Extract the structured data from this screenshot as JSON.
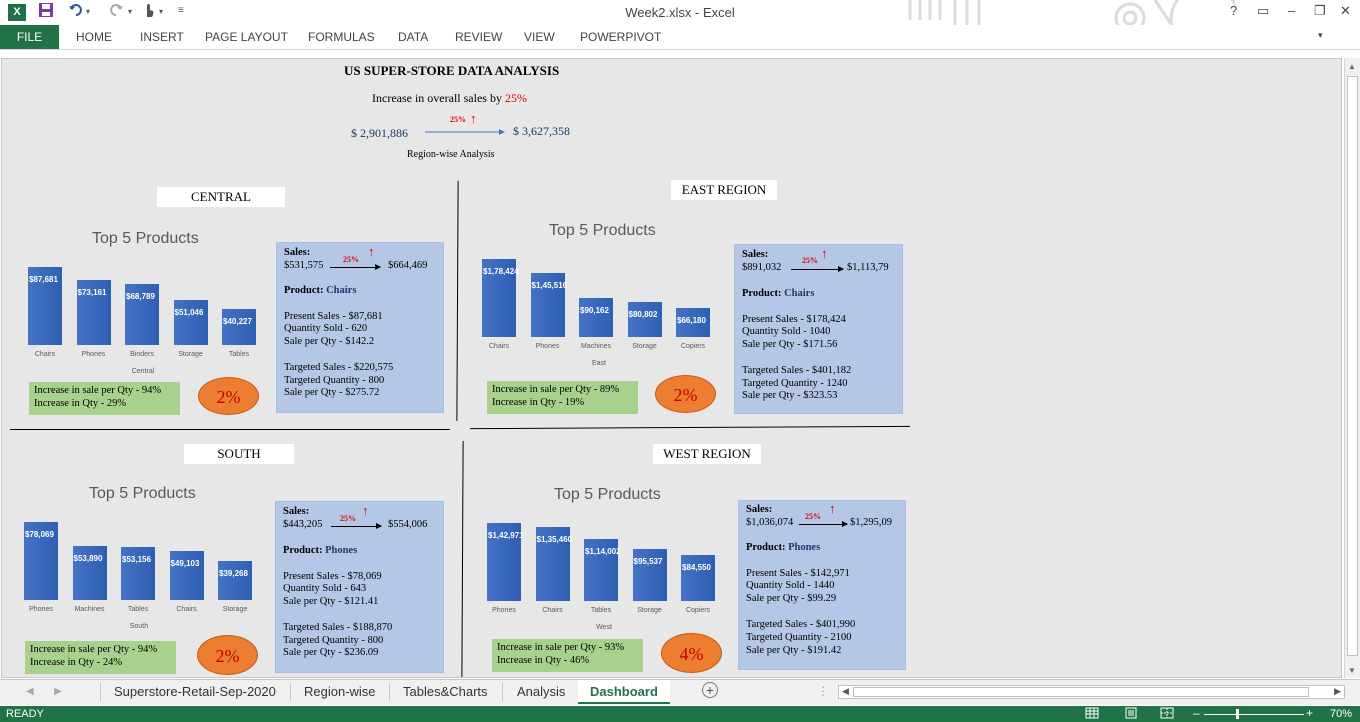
{
  "window": {
    "title": "Week2.xlsx - Excel",
    "app_icon": "X",
    "help": "?",
    "controls": [
      "▭",
      "–",
      "❐",
      "✕"
    ]
  },
  "ribbon": {
    "tabs": [
      "FILE",
      "HOME",
      "INSERT",
      "PAGE LAYOUT",
      "FORMULAS",
      "DATA",
      "REVIEW",
      "VIEW",
      "POWERPIVOT"
    ]
  },
  "dashboard": {
    "title": "US SUPER-STORE DATA ANALYSIS",
    "increase_text": "Increase in overall sales by ",
    "increase_pct": "25%",
    "from_value": "$ 2,901,886",
    "to_value": "$ 3,627,358",
    "arrow_pct": "25%",
    "subtitle": "Region-wise Analysis"
  },
  "regions": {
    "central": {
      "label": "CENTRAL",
      "chart_title": "Top 5 Products",
      "chart_data": {
        "type": "bar",
        "categories": [
          "Chairs",
          "Phones",
          "Binders",
          "Storage",
          "Tables"
        ],
        "values": [
          87681,
          73161,
          68789,
          51046,
          40227
        ],
        "data_labels": [
          "$87,681",
          "$73,161",
          "$68,789",
          "$51,046",
          "$40,227"
        ],
        "xlabel": "Central"
      },
      "sales_label": "Sales:",
      "sales_from": "$531,575",
      "sales_pct": "25%",
      "sales_to": "$664,469",
      "product_label": "Product: ",
      "product": "Chairs",
      "present_sales": "Present Sales - $87,681",
      "qty_sold": "Quantity Sold - 620",
      "sale_per_qty": "Sale per Qty - $142.2",
      "targeted_sales": "Targeted Sales - $220,575",
      "targeted_qty": "Targeted Quantity - 800",
      "target_sale_per_qty": "Sale per Qty - $275.72",
      "inc_sale_per_qty": "Increase in sale per Qty - 94%",
      "inc_qty": "Increase in Qty - 29%",
      "circle": "2%"
    },
    "east": {
      "label": "EAST REGION",
      "chart_title": "Top 5 Products",
      "chart_data": {
        "type": "bar",
        "categories": [
          "Chairs",
          "Phones",
          "Machines",
          "Storage",
          "Copiers"
        ],
        "values": [
          178424,
          145516,
          90162,
          80802,
          66180
        ],
        "data_labels": [
          "$1,78,424",
          "$1,45,516",
          "$90,162",
          "$80,802",
          "$66,180"
        ],
        "xlabel": "East"
      },
      "sales_label": "Sales:",
      "sales_from": "$891,032",
      "sales_pct": "25%",
      "sales_to": "$1,113,79",
      "product_label": "Product: ",
      "product": "Chairs",
      "present_sales": "Present Sales - $178,424",
      "qty_sold": "Quantity Sold - 1040",
      "sale_per_qty": "Sale per Qty - $171.56",
      "targeted_sales": "Targeted Sales - $401,182",
      "targeted_qty": "Targeted Quantity - 1240",
      "target_sale_per_qty": "Sale per Qty - $323.53",
      "inc_sale_per_qty": "Increase in sale per Qty - 89%",
      "inc_qty": "Increase in Qty - 19%",
      "circle": "2%"
    },
    "south": {
      "label": "SOUTH",
      "chart_title": "Top 5 Products",
      "chart_data": {
        "type": "bar",
        "categories": [
          "Phones",
          "Machines",
          "Tables",
          "Chairs",
          "Storage"
        ],
        "values": [
          78069,
          53890,
          53156,
          49103,
          39268
        ],
        "data_labels": [
          "$78,069",
          "$53,890",
          "$53,156",
          "$49,103",
          "$39,268"
        ],
        "xlabel": "South"
      },
      "sales_label": "Sales:",
      "sales_from": "$443,205",
      "sales_pct": "25%",
      "sales_to": "$554,006",
      "product_label": "Product: ",
      "product": "Phones",
      "present_sales": "Present Sales - $78,069",
      "qty_sold": "Quantity Sold - 643",
      "sale_per_qty": "Sale per Qty - $121.41",
      "targeted_sales": "Targeted Sales - $188,870",
      "targeted_qty": "Targeted Quantity - 800",
      "target_sale_per_qty": "Sale per Qty - $236.09",
      "inc_sale_per_qty": "Increase in sale per Qty - 94%",
      "inc_qty": "Increase in Qty - 24%",
      "circle": "2%"
    },
    "west": {
      "label": "WEST REGION",
      "chart_title": "Top 5 Products",
      "chart_data": {
        "type": "bar",
        "categories": [
          "Phones",
          "Chairs",
          "Tables",
          "Storage",
          "Copiers"
        ],
        "values": [
          142971,
          135460,
          114002,
          95537,
          84550
        ],
        "data_labels": [
          "$1,42,971",
          "$1,35,460",
          "$1,14,002",
          "$95,537",
          "$84,550"
        ],
        "xlabel": "West"
      },
      "sales_label": "Sales:",
      "sales_from": "$1,036,074",
      "sales_pct": "25%",
      "sales_to": "$1,295,09",
      "product_label": "Product: ",
      "product": "Phones",
      "present_sales": "Present Sales - $142,971",
      "qty_sold": "Quantity Sold - 1440",
      "sale_per_qty": "Sale per Qty - $99.29",
      "targeted_sales": "Targeted Sales - $401,990",
      "targeted_qty": "Targeted Quantity - 2100",
      "target_sale_per_qty": "Sale per Qty - $191.42",
      "inc_sale_per_qty": "Increase in sale per Qty - 93%",
      "inc_qty": "Increase in Qty - 46%",
      "circle": "4%"
    }
  },
  "sheet_tabs": [
    "Superstore-Retail-Sep-2020",
    "Region-wise",
    "Tables&Charts",
    "Analysis",
    "Dashboard"
  ],
  "active_sheet": "Dashboard",
  "status": {
    "ready": "READY",
    "zoom": "70%"
  },
  "colors": {
    "excel_green": "#217346",
    "bar_blue": "#4472c4",
    "info_blue": "#b4c7e7",
    "green_box": "#a9d18e",
    "orange": "#ed7d31",
    "red": "#e00000"
  }
}
